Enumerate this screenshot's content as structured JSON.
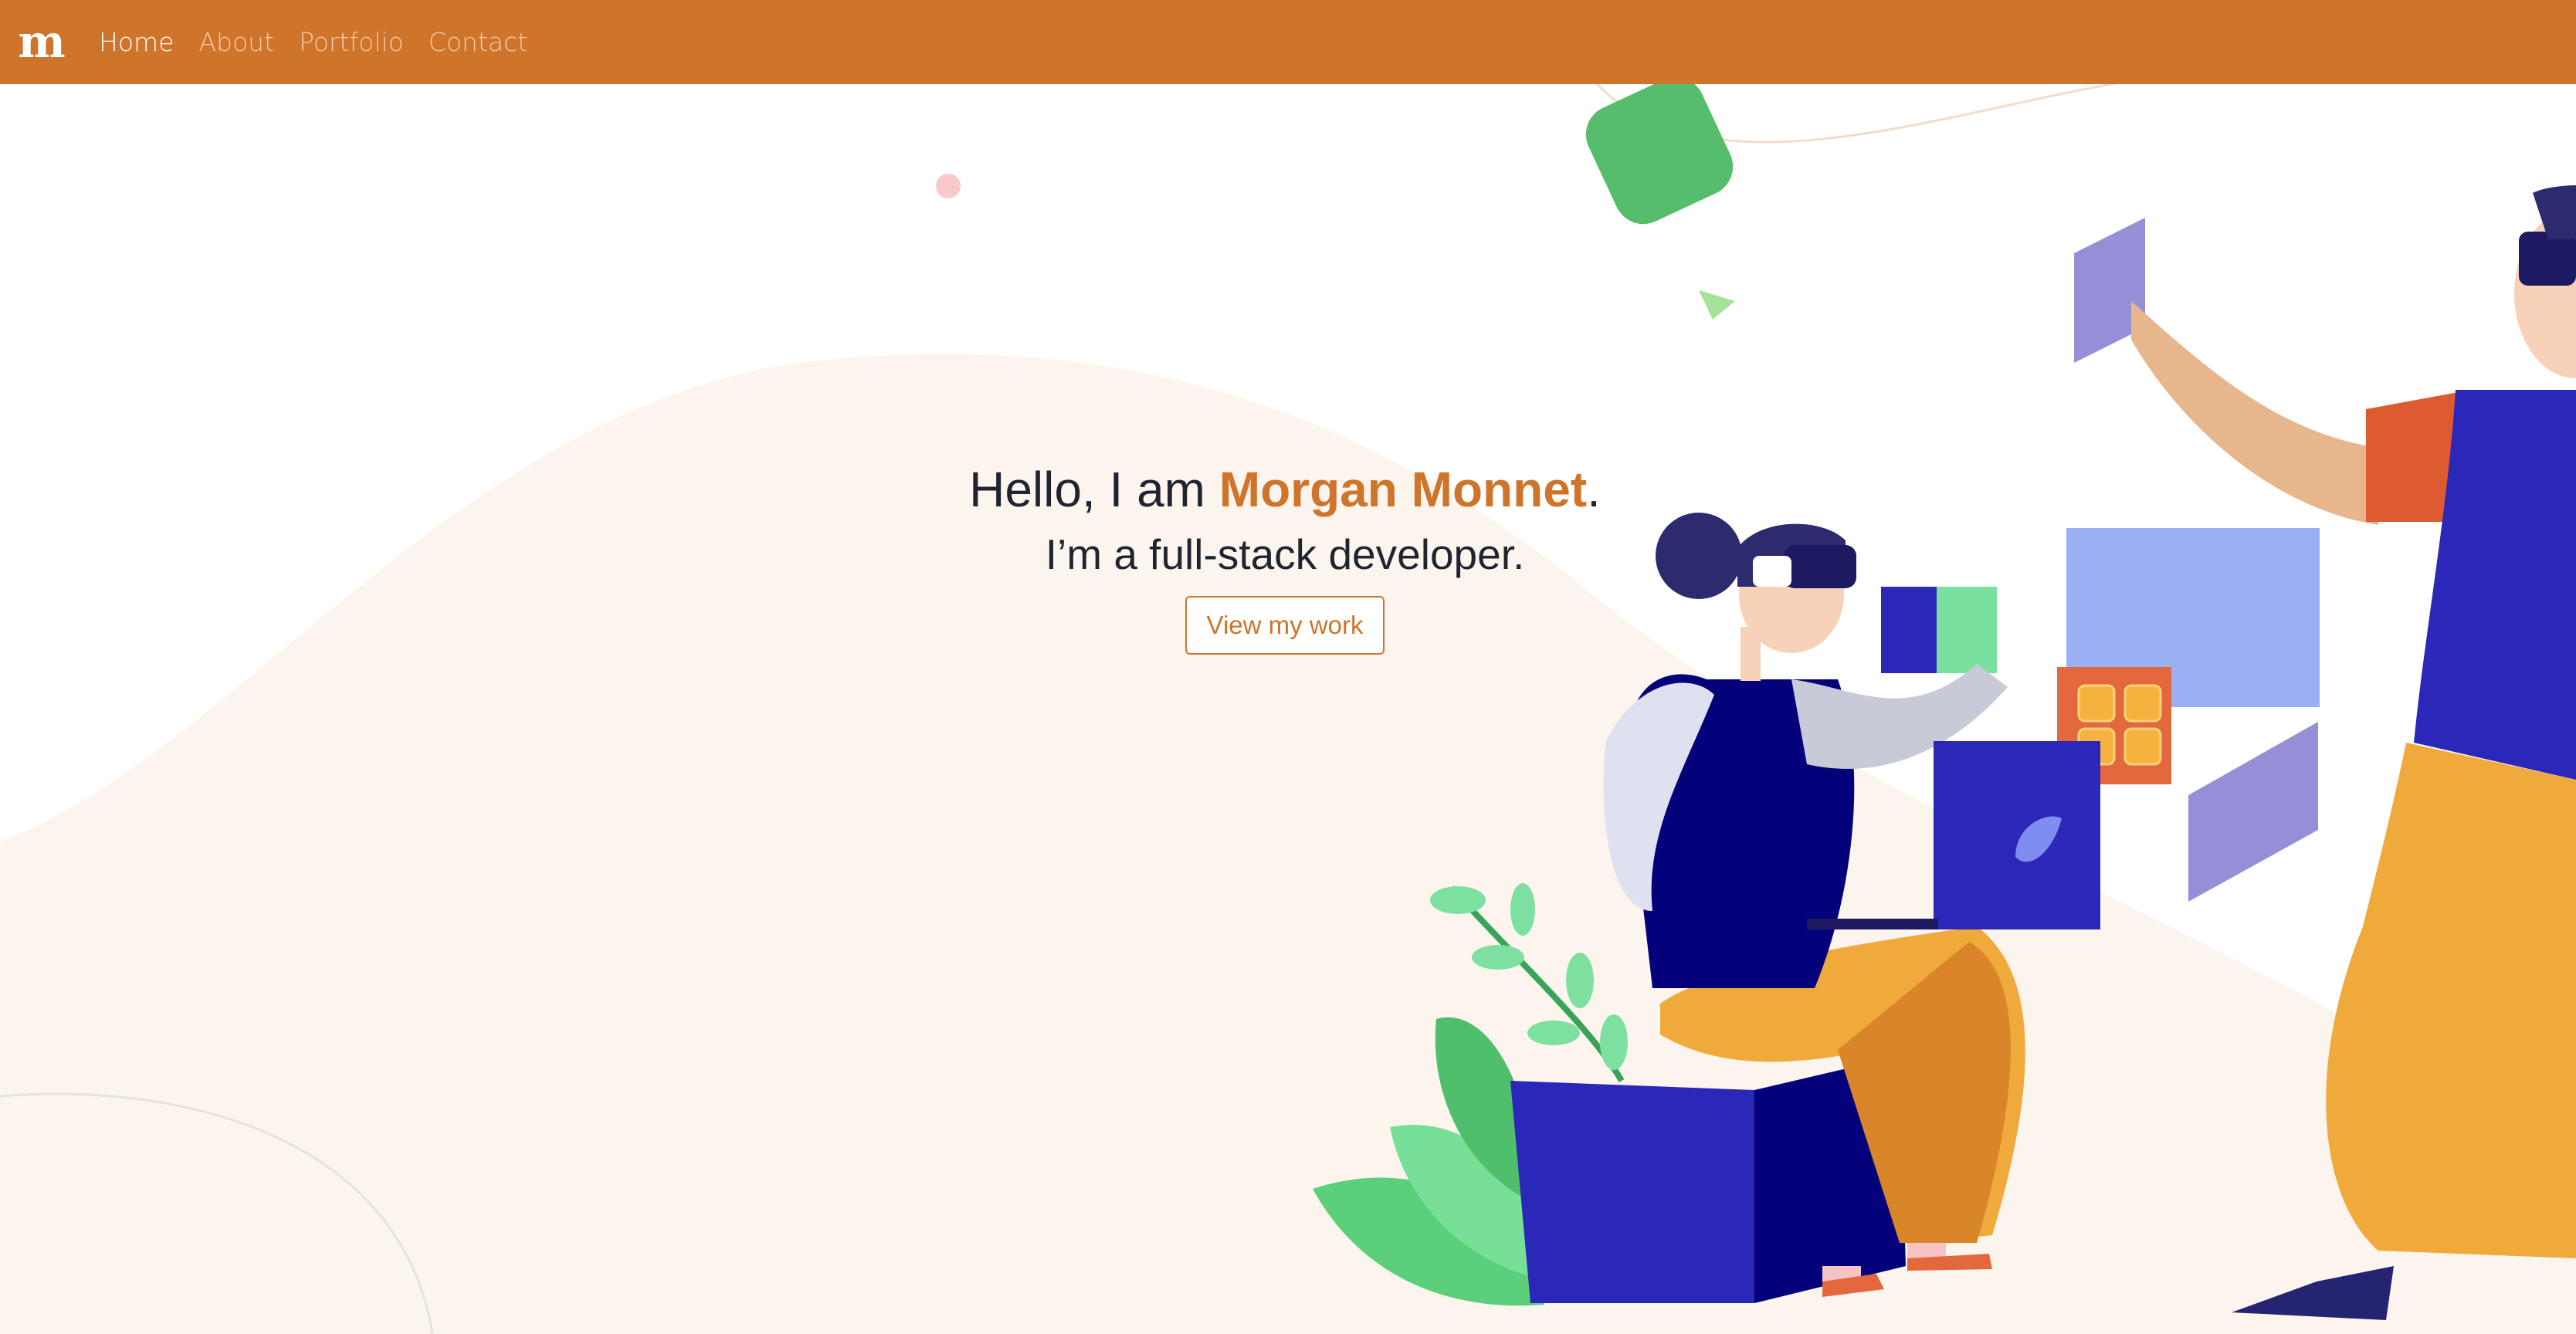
{
  "nav": {
    "logo": "m",
    "links": [
      {
        "label": "Home",
        "active": true
      },
      {
        "label": "About",
        "active": false
      },
      {
        "label": "Portfolio",
        "active": false
      },
      {
        "label": "Contact",
        "active": false
      }
    ]
  },
  "hero": {
    "greeting_prefix": "Hello, I am ",
    "name": "Morgan Monnet",
    "greeting_suffix": ".",
    "subtitle": "I’m a full-stack developer.",
    "cta_label": "View my work"
  },
  "colors": {
    "accent": "#cf742b",
    "text": "#1f2430",
    "background_wave": "#fcf5ee",
    "illustration_blue": "#2b27b8",
    "illustration_green": "#56bd6d",
    "illustration_orange": "#f0aa3c"
  }
}
